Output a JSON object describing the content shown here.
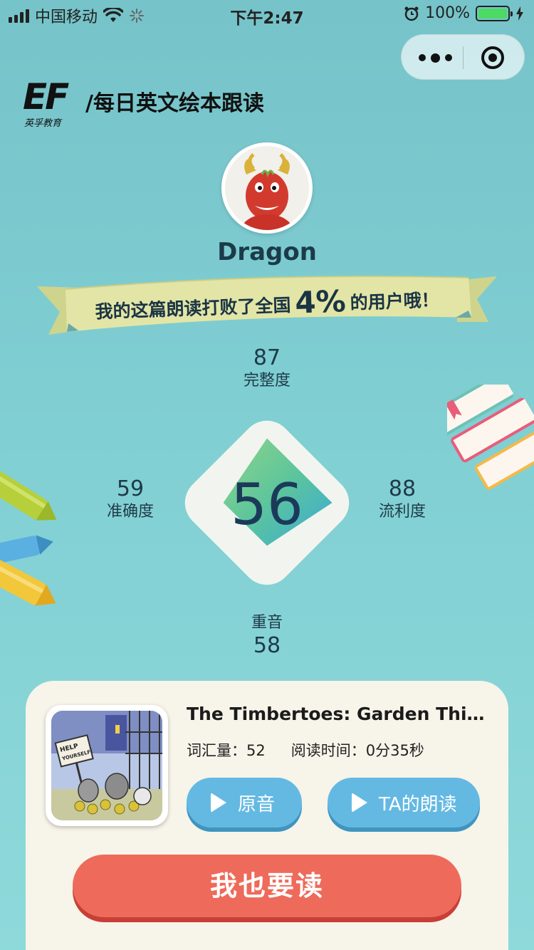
{
  "status_bar": {
    "carrier": "中国移动",
    "time": "下午2:47",
    "battery_percent": "100%"
  },
  "capsule": {
    "more_icon": "more-dots-icon",
    "close_icon": "target-circle-icon"
  },
  "brand": {
    "logo_text": "EF",
    "logo_subtitle": "英孚教育",
    "title": "/每日英文绘本跟读"
  },
  "user": {
    "name": "Dragon"
  },
  "banner": {
    "prefix": "我的这篇朗读打败了全国",
    "percent": "4%",
    "suffix": "的用户哦！"
  },
  "scores": {
    "total": "56",
    "completeness": {
      "value": "87",
      "label": "完整度"
    },
    "accuracy": {
      "value": "59",
      "label": "准确度"
    },
    "fluency": {
      "value": "88",
      "label": "流利度"
    },
    "stress": {
      "value": "58",
      "label": "重音"
    }
  },
  "book": {
    "title": "The Timbertoes: Garden Thi...",
    "vocab": "词汇量：52",
    "read_time": "阅读时间：0分35秒",
    "cover_sign": "HELP YOURSELF!"
  },
  "buttons": {
    "original_audio": "原音",
    "their_reading": "TA的朗读",
    "cta": "我也要读"
  },
  "colors": {
    "background": "#80cfd3",
    "cta": "#ee6a5a",
    "pill": "#64b9e3",
    "banner": "#dfe2a0"
  }
}
